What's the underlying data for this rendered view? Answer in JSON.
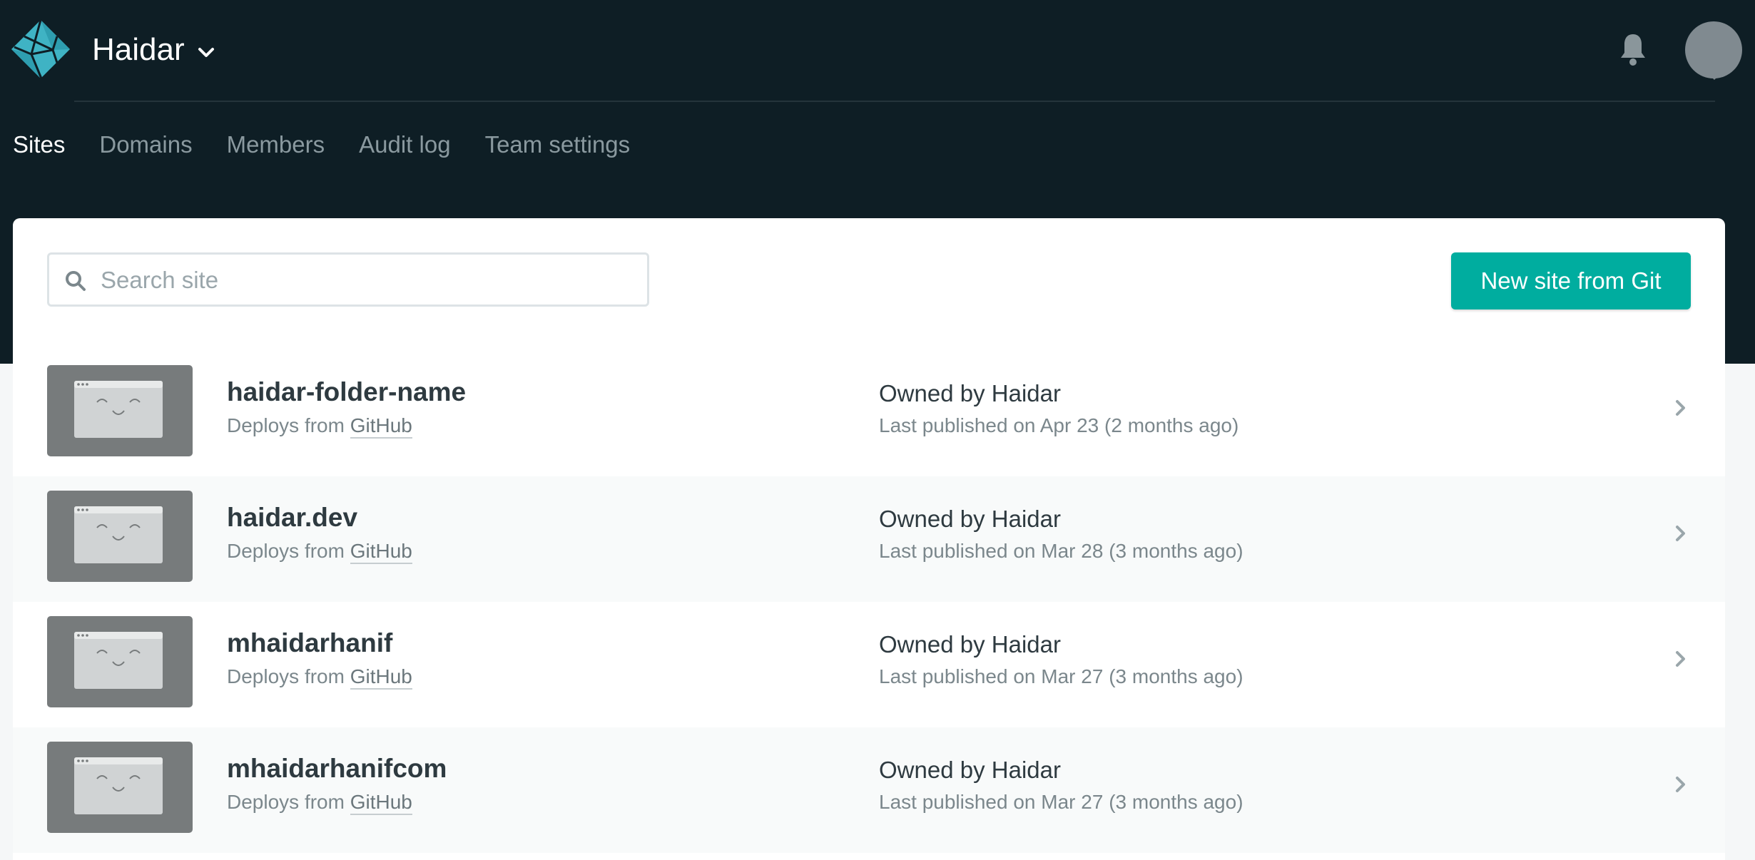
{
  "app": {
    "team_name": "Haidar",
    "icons": {
      "logo": "netlify-logo-icon",
      "team_menu": "chevron-down-icon",
      "notifications": "bell-icon",
      "avatar": "user-avatar"
    }
  },
  "nav": {
    "items": [
      {
        "label": "Sites",
        "active": true
      },
      {
        "label": "Domains",
        "active": false
      },
      {
        "label": "Members",
        "active": false
      },
      {
        "label": "Audit log",
        "active": false
      },
      {
        "label": "Team settings",
        "active": false
      }
    ]
  },
  "search": {
    "placeholder": "Search site",
    "value": ""
  },
  "toolbar": {
    "new_site_label": "New site from Git"
  },
  "sites": [
    {
      "name": "haidar-folder-name",
      "deploy_prefix": "Deploys from",
      "provider": "GitHub",
      "owner_prefix": "Owned by",
      "owner": "Haidar",
      "published": "Last published on Apr 23 (2 months ago)"
    },
    {
      "name": "haidar.dev",
      "deploy_prefix": "Deploys from",
      "provider": "GitHub",
      "owner_prefix": "Owned by",
      "owner": "Haidar",
      "published": "Last published on Mar 28 (3 months ago)"
    },
    {
      "name": "mhaidarhanif",
      "deploy_prefix": "Deploys from",
      "provider": "GitHub",
      "owner_prefix": "Owned by",
      "owner": "Haidar",
      "published": "Last published on Mar 27 (3 months ago)"
    },
    {
      "name": "mhaidarhanifcom",
      "deploy_prefix": "Deploys from",
      "provider": "GitHub",
      "owner_prefix": "Owned by",
      "owner": "Haidar",
      "published": "Last published on Mar 27 (3 months ago)"
    }
  ],
  "colors": {
    "header_bg": "#0e1e25",
    "accent": "#00ad9f",
    "nav_active": "#ffffff",
    "nav_inactive": "#8a999f"
  }
}
